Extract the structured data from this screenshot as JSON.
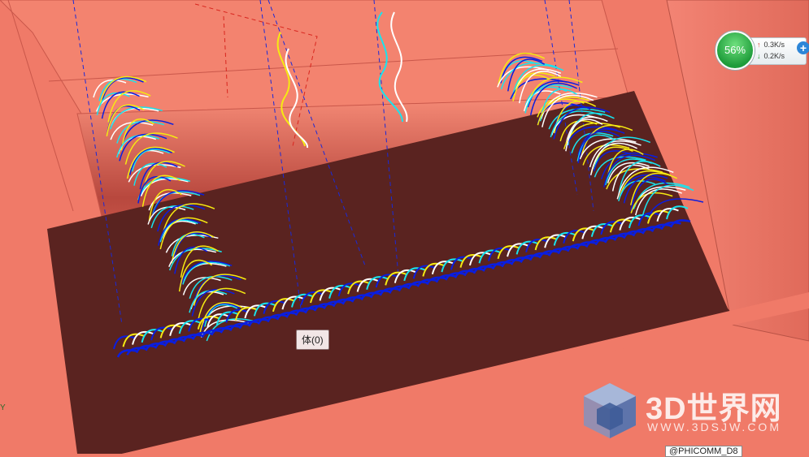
{
  "viewport": {
    "tooltip": "体(0)",
    "axis_label": "Y"
  },
  "network_monitor": {
    "percent": "56%",
    "upload": "0.3K/s",
    "download": "0.2K/s",
    "expand_symbol": "+"
  },
  "watermark": {
    "brand": "3D世界网",
    "url": "WWW.3DSJW.COM"
  },
  "corner_tag": "@PHICOMM_D8",
  "colors": {
    "surface": "#f07a68",
    "floor": "#5a2320",
    "toolpath_blue": "#0a1ee0",
    "toolpath_cyan": "#18e4ef",
    "toolpath_yellow": "#f5ea12",
    "toolpath_white": "#ffffff"
  }
}
